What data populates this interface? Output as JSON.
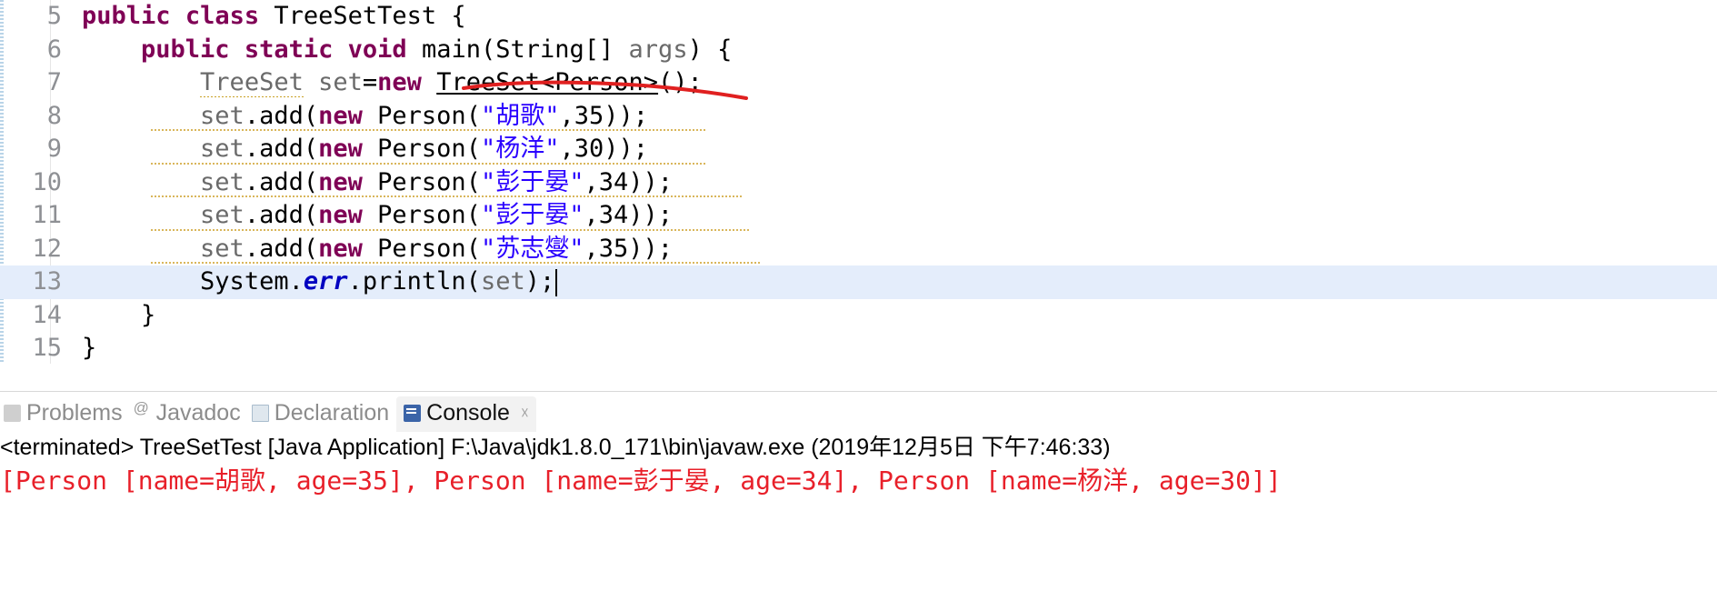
{
  "editor": {
    "first_line_number": 5,
    "current_line_number": 13,
    "fold_marker_line": 6,
    "colors": {
      "keyword": "#7f0055",
      "string": "#2a00ff",
      "static_field": "#0000c0",
      "local_var": "#6a6a6a",
      "warning_squiggle": "#d9b65b",
      "current_line_bg": "#e4edfb",
      "annotation_red": "#e02020"
    },
    "lines": [
      {
        "number": "5",
        "tokens": [
          {
            "t": "public",
            "c": "kw"
          },
          {
            "t": " ",
            "c": "plain"
          },
          {
            "t": "class",
            "c": "kw"
          },
          {
            "t": " ",
            "c": "plain"
          },
          {
            "t": "TreeSetTest",
            "c": "plain"
          },
          {
            "t": " {",
            "c": "plain"
          }
        ]
      },
      {
        "number": "6",
        "tokens": [
          {
            "t": "    ",
            "c": "plain"
          },
          {
            "t": "public",
            "c": "kw"
          },
          {
            "t": " ",
            "c": "plain"
          },
          {
            "t": "static",
            "c": "kw"
          },
          {
            "t": " ",
            "c": "plain"
          },
          {
            "t": "void",
            "c": "kw"
          },
          {
            "t": " ",
            "c": "plain"
          },
          {
            "t": "main",
            "c": "plain"
          },
          {
            "t": "(String[] ",
            "c": "plain"
          },
          {
            "t": "args",
            "c": "local"
          },
          {
            "t": ") {",
            "c": "plain"
          }
        ]
      },
      {
        "number": "7",
        "tokens": [
          {
            "t": "        ",
            "c": "plain"
          },
          {
            "t": "TreeSet",
            "c": "local"
          },
          {
            "t": " ",
            "c": "plain"
          },
          {
            "t": "set",
            "c": "local"
          },
          {
            "t": "=",
            "c": "plain"
          },
          {
            "t": "new",
            "c": "kw"
          },
          {
            "t": " ",
            "c": "plain"
          },
          {
            "t": "TreeSet<Person>",
            "c": "uline"
          },
          {
            "t": "();",
            "c": "plain"
          }
        ]
      },
      {
        "number": "8",
        "tokens": [
          {
            "t": "        ",
            "c": "plain"
          },
          {
            "t": "set",
            "c": "local"
          },
          {
            "t": ".add(",
            "c": "plain"
          },
          {
            "t": "new",
            "c": "kw"
          },
          {
            "t": " ",
            "c": "plain"
          },
          {
            "t": "Person(",
            "c": "plain"
          },
          {
            "t": "\"胡歌\"",
            "c": "str"
          },
          {
            "t": ",35));",
            "c": "plain"
          }
        ]
      },
      {
        "number": "9",
        "tokens": [
          {
            "t": "        ",
            "c": "plain"
          },
          {
            "t": "set",
            "c": "local"
          },
          {
            "t": ".add(",
            "c": "plain"
          },
          {
            "t": "new",
            "c": "kw"
          },
          {
            "t": " ",
            "c": "plain"
          },
          {
            "t": "Person(",
            "c": "plain"
          },
          {
            "t": "\"杨洋\"",
            "c": "str"
          },
          {
            "t": ",30));",
            "c": "plain"
          }
        ]
      },
      {
        "number": "10",
        "tokens": [
          {
            "t": "        ",
            "c": "plain"
          },
          {
            "t": "set",
            "c": "local"
          },
          {
            "t": ".add(",
            "c": "plain"
          },
          {
            "t": "new",
            "c": "kw"
          },
          {
            "t": " ",
            "c": "plain"
          },
          {
            "t": "Person(",
            "c": "plain"
          },
          {
            "t": "\"彭于晏\"",
            "c": "str"
          },
          {
            "t": ",34));",
            "c": "plain"
          }
        ]
      },
      {
        "number": "11",
        "tokens": [
          {
            "t": "        ",
            "c": "plain"
          },
          {
            "t": "set",
            "c": "local"
          },
          {
            "t": ".add(",
            "c": "plain"
          },
          {
            "t": "new",
            "c": "kw"
          },
          {
            "t": " ",
            "c": "plain"
          },
          {
            "t": "Person(",
            "c": "plain"
          },
          {
            "t": "\"彭于晏\"",
            "c": "str"
          },
          {
            "t": ",34));",
            "c": "plain"
          }
        ]
      },
      {
        "number": "12",
        "tokens": [
          {
            "t": "        ",
            "c": "plain"
          },
          {
            "t": "set",
            "c": "local"
          },
          {
            "t": ".add(",
            "c": "plain"
          },
          {
            "t": "new",
            "c": "kw"
          },
          {
            "t": " ",
            "c": "plain"
          },
          {
            "t": "Person(",
            "c": "plain"
          },
          {
            "t": "\"苏志燮\"",
            "c": "str"
          },
          {
            "t": ",35));",
            "c": "plain"
          }
        ]
      },
      {
        "number": "13",
        "tokens": [
          {
            "t": "        ",
            "c": "plain"
          },
          {
            "t": "System.",
            "c": "plain"
          },
          {
            "t": "err",
            "c": "field"
          },
          {
            "t": ".println(",
            "c": "plain"
          },
          {
            "t": "set",
            "c": "local"
          },
          {
            "t": ");",
            "c": "plain"
          }
        ]
      },
      {
        "number": "14",
        "tokens": [
          {
            "t": "    }",
            "c": "plain"
          }
        ]
      },
      {
        "number": "15",
        "tokens": [
          {
            "t": "}",
            "c": "plain"
          }
        ]
      }
    ],
    "scroll_left_arrow": "‹"
  },
  "bottom_panel": {
    "tabs": [
      {
        "label": "Problems",
        "icon": "problems-icon",
        "active": false,
        "closable": false
      },
      {
        "label": "Javadoc",
        "icon": "javadoc-icon",
        "active": false,
        "closable": false
      },
      {
        "label": "Declaration",
        "icon": "declaration-icon",
        "active": false,
        "closable": false
      },
      {
        "label": "Console",
        "icon": "console-icon",
        "active": true,
        "closable": true
      }
    ],
    "close_glyph": "☓",
    "console": {
      "process_line": "<terminated> TreeSetTest [Java Application] F:\\Java\\jdk1.8.0_171\\bin\\javaw.exe (2019年12月5日 下午7:46:33)",
      "output": "[Person [name=胡歌, age=35], Person [name=彭于晏, age=34], Person [name=杨洋, age=30]]"
    }
  }
}
